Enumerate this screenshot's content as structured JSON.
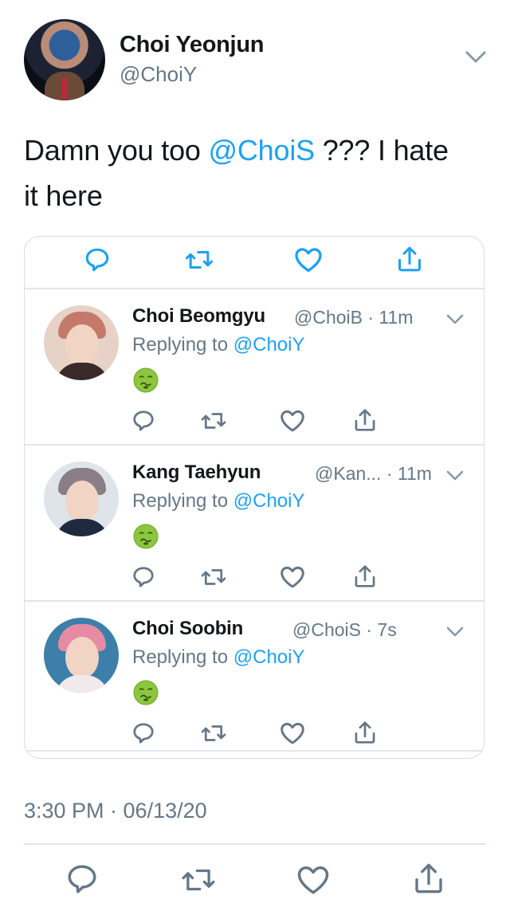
{
  "tweet": {
    "author_name": "Choi Yeonjun",
    "author_handle": "@ChoiY",
    "text_before": "Damn you too ",
    "mention": "@ChoiS",
    "text_after": " ??? I hate it here",
    "timestamp": "3:30 PM · 06/13/20"
  },
  "replies": [
    {
      "name": "Choi Beomgyu",
      "meta": "@ChoiB · 11m",
      "replying_prefix": "Replying to ",
      "replying_handle": "@ChoiY",
      "emoji": "nauseated-face"
    },
    {
      "name": "Kang Taehyun",
      "meta": "@Kan... · 11m",
      "replying_prefix": "Replying to ",
      "replying_handle": "@ChoiY",
      "emoji": "nauseated-face"
    },
    {
      "name": "Choi Soobin",
      "meta": "@ChoiS · 7s",
      "replying_prefix": "Replying to ",
      "replying_handle": "@ChoiY",
      "emoji": "nauseated-face"
    }
  ],
  "icons": {
    "reply": "reply-icon",
    "retweet": "retweet-icon",
    "like": "heart-icon",
    "share": "share-icon",
    "more": "chevron-down-icon"
  },
  "colors": {
    "link": "#1da1f2",
    "secondary_text": "#657786",
    "primary_text": "#14171a",
    "divider": "#e1e6ea"
  }
}
